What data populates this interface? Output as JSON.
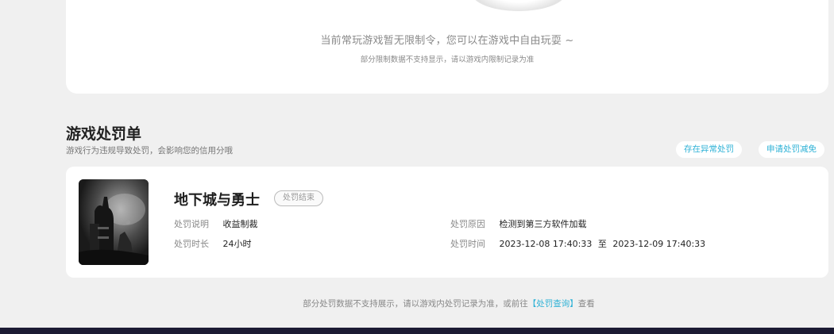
{
  "top_card": {
    "main_text": "当前常玩游戏暂无限制令，您可以在游戏中自由玩耍 ~",
    "sub_text": "部分限制数据不支持显示，请以游戏内限制记录为准"
  },
  "section": {
    "title": "游戏处罚单",
    "subtitle": "游戏行为违规导致处罚，会影响您的信用分哦",
    "buttons": [
      "存在异常处罚",
      "申请处罚减免"
    ]
  },
  "punishment": {
    "game_name": "地下城与勇士",
    "status": "处罚结束",
    "desc_label": "处罚说明",
    "desc_value": "收益制裁",
    "duration_label": "处罚时长",
    "duration_value": "24小时",
    "reason_label": "处罚原因",
    "reason_value": "检测到第三方软件加载",
    "time_label": "处罚时间",
    "time_start": "2023-12-08 17:40:33",
    "time_sep": "至",
    "time_end": "2023-12-09 17:40:33"
  },
  "bottom_note": {
    "text": "部分处罚数据不支持展示，请以游戏内处罚记录为准，或前往",
    "link": "【处罚查询】",
    "suffix": "查看"
  },
  "colors": {
    "accent": "#2fb2d6",
    "background": "#f0f0f0",
    "card": "#ffffff",
    "footer": "#1c1b33"
  }
}
